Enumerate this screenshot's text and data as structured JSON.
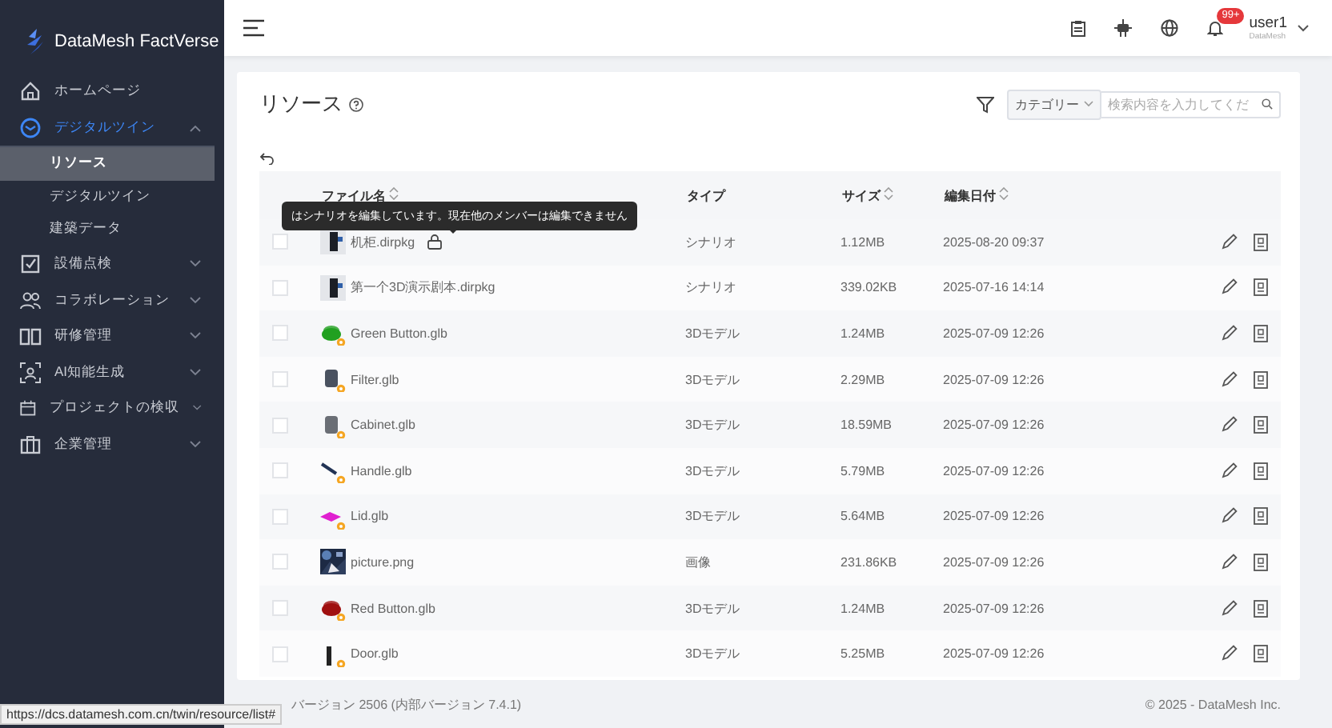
{
  "app": {
    "name": "DataMesh FactVerse"
  },
  "sidebar": {
    "items": [
      {
        "label": "ホームページ",
        "active": false
      },
      {
        "label": "デジタルツイン",
        "expanded": true,
        "active": true,
        "children": [
          {
            "label": "リソース",
            "selected": true
          },
          {
            "label": "デジタルツイン",
            "selected": false
          },
          {
            "label": "建築データ",
            "selected": false
          }
        ]
      },
      {
        "label": "設備点検",
        "expanded": false,
        "active": false
      },
      {
        "label": "コラボレーション",
        "expanded": false,
        "active": false
      },
      {
        "label": "研修管理",
        "expanded": false,
        "active": false
      },
      {
        "label": "AI知能生成",
        "expanded": false,
        "active": false
      },
      {
        "label": "プロジェクトの検収",
        "expanded": false,
        "active": false
      },
      {
        "label": "企業管理",
        "expanded": false,
        "active": false
      }
    ]
  },
  "topbar": {
    "notification_badge": "99+",
    "user": {
      "name": "user1",
      "org": "DataMesh"
    }
  },
  "page": {
    "title": "リソース",
    "category": "カテゴリー",
    "search": {
      "placeholder": "検索内容を入力してくだ"
    }
  },
  "table": {
    "columns": [
      {
        "label": "ファイル名",
        "sortable": true
      },
      {
        "label": "タイプ",
        "sortable": false
      },
      {
        "label": "サイズ",
        "sortable": true
      },
      {
        "label": "編集日付",
        "sortable": true
      }
    ],
    "tooltip": "はシナリオを編集しています。現在他のメンバーは編集できません",
    "rows": [
      {
        "name": "机柜.dirpkg",
        "type": "シナリオ",
        "size": "1.12MB",
        "date": "2025-08-20 09:37",
        "checked": false,
        "locked": true,
        "thumbnail": {
          "kind": "scenario"
        }
      },
      {
        "name": "第一个3D演示剧本.dirpkg",
        "type": "シナリオ",
        "size": "339.02KB",
        "date": "2025-07-16 14:14",
        "checked": false,
        "locked": false,
        "thumbnail": {
          "kind": "scenario"
        }
      },
      {
        "name": "Green Button.glb",
        "type": "3Dモデル",
        "size": "1.24MB",
        "date": "2025-07-09 12:26",
        "checked": false,
        "locked": false,
        "thumbnail": {
          "kind": "button",
          "color": "#22a020"
        }
      },
      {
        "name": "Filter.glb",
        "type": "3Dモデル",
        "size": "2.29MB",
        "date": "2025-07-09 12:26",
        "checked": false,
        "locked": false,
        "thumbnail": {
          "kind": "cylinder",
          "color": "#4a5260"
        }
      },
      {
        "name": "Cabinet.glb",
        "type": "3Dモデル",
        "size": "18.59MB",
        "date": "2025-07-09 12:26",
        "checked": false,
        "locked": false,
        "thumbnail": {
          "kind": "cylinder",
          "color": "#6a6e75"
        }
      },
      {
        "name": "Handle.glb",
        "type": "3Dモデル",
        "size": "5.79MB",
        "date": "2025-07-09 12:26",
        "checked": false,
        "locked": false,
        "thumbnail": {
          "kind": "handle",
          "color": "#223355"
        }
      },
      {
        "name": "Lid.glb",
        "type": "3Dモデル",
        "size": "5.64MB",
        "date": "2025-07-09 12:26",
        "checked": false,
        "locked": false,
        "thumbnail": {
          "kind": "lid",
          "color": "#e020d0"
        }
      },
      {
        "name": "picture.png",
        "type": "画像",
        "size": "231.86KB",
        "date": "2025-07-09 12:26",
        "checked": false,
        "locked": false
      },
      {
        "name": "Red Button.glb",
        "type": "3Dモデル",
        "size": "1.24MB",
        "date": "2025-07-09 12:26",
        "checked": false,
        "locked": false,
        "thumbnail": {
          "kind": "button",
          "color": "#a01010"
        }
      },
      {
        "name": "Door.glb",
        "type": "3Dモデル",
        "size": "5.25MB",
        "date": "2025-07-09 12:26",
        "checked": false,
        "locked": false,
        "thumbnail": {
          "kind": "door",
          "color": "#222222"
        }
      }
    ]
  },
  "footer": {
    "version": "バージョン 2506 (内部バージョン 7.4.1)",
    "copyright": "© 2025 - DataMesh Inc."
  },
  "status_url": "https://dcs.datamesh.com.cn/twin/resource/list#"
}
